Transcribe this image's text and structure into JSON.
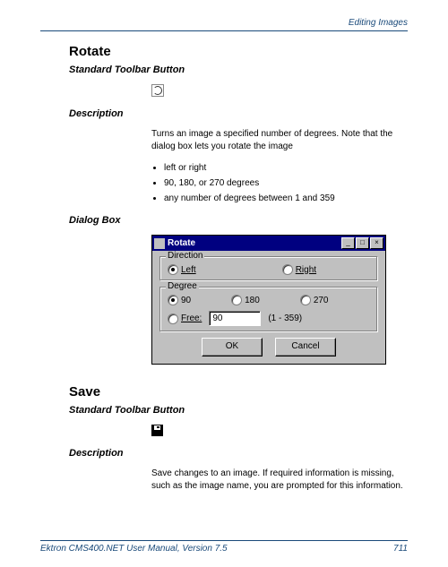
{
  "header": {
    "section": "Editing Images"
  },
  "rotate": {
    "title": "Rotate",
    "toolbar_heading": "Standard Toolbar Button",
    "description_heading": "Description",
    "description_text": "Turns an image a specified number of degrees. Note that the dialog box lets you rotate the image",
    "bullets": [
      "left or right",
      "90, 180, or 270 degrees",
      "any number of degrees between 1 and 359"
    ],
    "dialog_heading": "Dialog Box",
    "dialog": {
      "title": "Rotate",
      "min_label": "_",
      "max_label": "□",
      "close_label": "×",
      "direction": {
        "legend": "Direction",
        "left": "Left",
        "right": "Right",
        "selected": "left"
      },
      "degree": {
        "legend": "Degree",
        "d90": "90",
        "d180": "180",
        "d270": "270",
        "free": "Free:",
        "free_value": "90",
        "range": "(1 - 359)",
        "selected": "90"
      },
      "ok": "OK",
      "cancel": "Cancel"
    }
  },
  "save": {
    "title": "Save",
    "toolbar_heading": "Standard Toolbar Button",
    "description_heading": "Description",
    "description_text": "Save changes to an image. If required information is missing, such as the image name, you are prompted for this information."
  },
  "footer": {
    "manual": "Ektron CMS400.NET User Manual, Version 7.5",
    "page": "711"
  }
}
